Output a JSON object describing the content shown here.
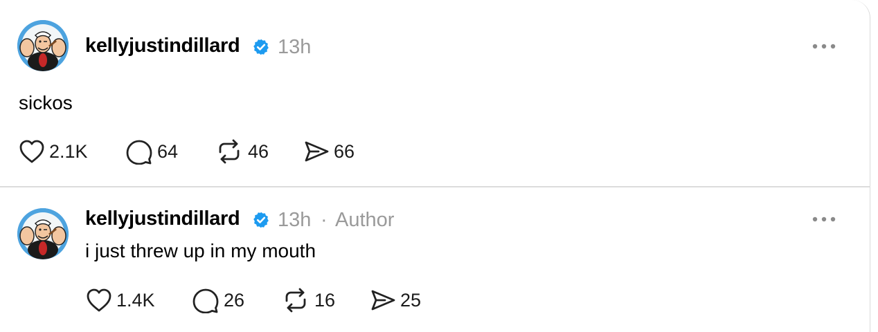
{
  "posts": [
    {
      "username": "kellyjustindillard",
      "time": "13h",
      "author_tag": "",
      "text": "sickos",
      "likes": "2.1K",
      "replies": "64",
      "reposts": "46",
      "shares": "66"
    },
    {
      "username": "kellyjustindillard",
      "time": "13h",
      "separator": "·",
      "author_tag": "Author",
      "text": "i just threw up in my mouth",
      "likes": "1.4K",
      "replies": "26",
      "reposts": "16",
      "shares": "25"
    }
  ],
  "colors": {
    "verified": "#1d9bf0",
    "meta": "#9a9a9a",
    "avatar_bg": "#4da3df",
    "divider": "#dcdcdc"
  },
  "icons": [
    "verified-badge-icon",
    "more-options-icon",
    "heart-icon",
    "comment-icon",
    "repost-icon",
    "share-icon"
  ]
}
